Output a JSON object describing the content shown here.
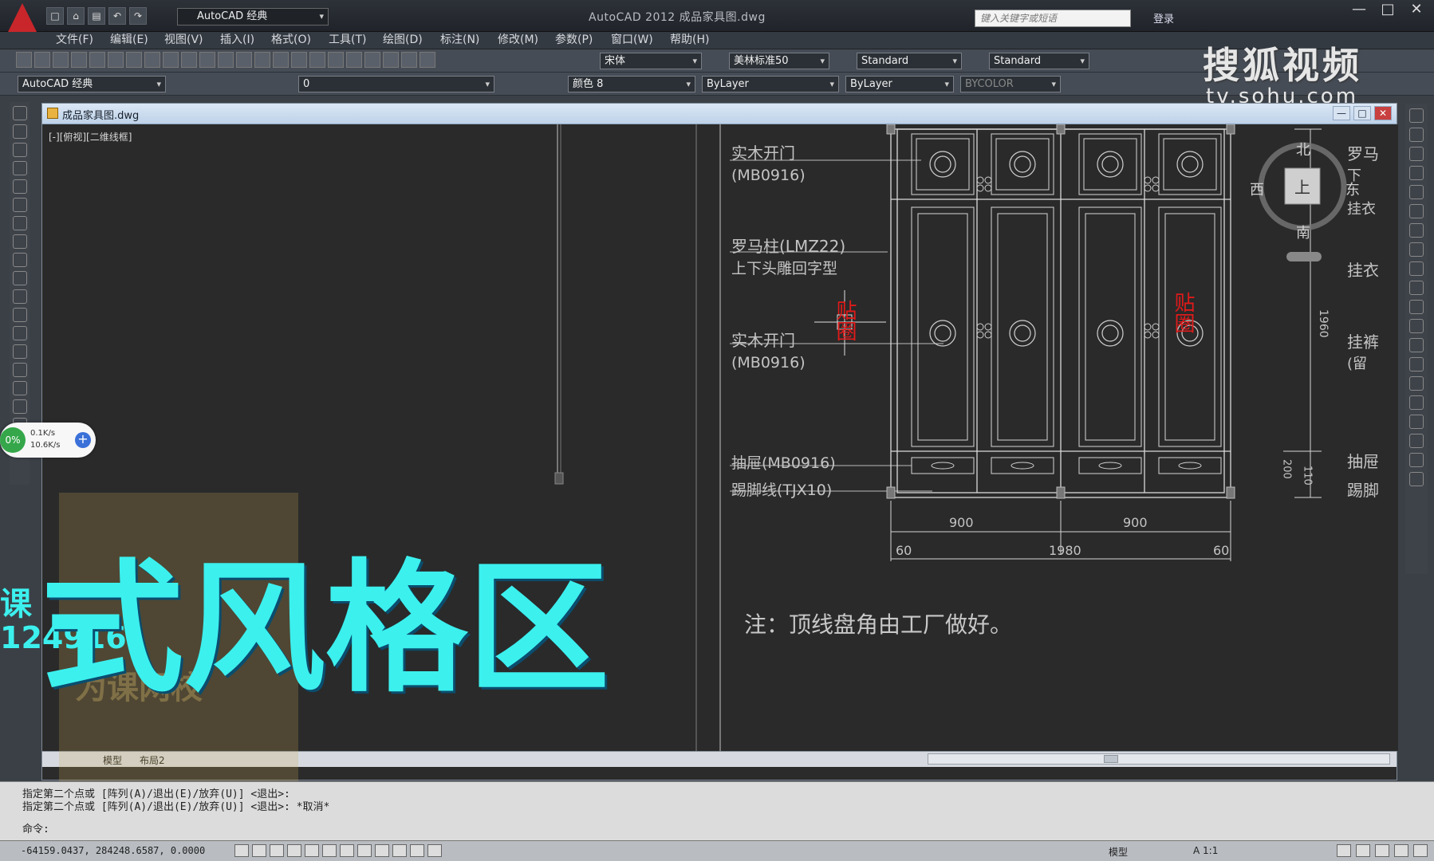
{
  "title_bar": {
    "workspace_label": "AutoCAD 经典",
    "window_title": "AutoCAD 2012  成品家具图.dwg",
    "search_placeholder": "键入关键字或短语",
    "login_label": "登录",
    "controls": [
      "—",
      "□",
      "✕"
    ]
  },
  "menu": [
    "文件(F)",
    "编辑(E)",
    "视图(V)",
    "插入(I)",
    "格式(O)",
    "工具(T)",
    "绘图(D)",
    "标注(N)",
    "修改(M)",
    "参数(P)",
    "窗口(W)",
    "帮助(H)"
  ],
  "toolbar": {
    "font_name": "宋体",
    "dim_style": "美林标准50",
    "text_style": "Standard",
    "table_style": "Standard",
    "workspace2": "AutoCAD 经典",
    "layer": "0",
    "color": "颜色 8",
    "linetype": "ByLayer",
    "lineweight": "ByLayer",
    "plot_style": "BYCOLOR"
  },
  "watermark": {
    "logo": "搜狐视频",
    "url": "tv.sohu.com"
  },
  "document": {
    "tab_title": "成品家具图.dwg",
    "viewport_label": "[-][俯视][二维线框]",
    "controls": [
      "—",
      "□",
      "✕"
    ]
  },
  "drawing": {
    "labels": {
      "door_top": "实木开门",
      "door_top_code": "(MB0916)",
      "roman_column": "罗马柱(LMZ22)",
      "roman_column_note": "上下头雕回字型",
      "door_mid": "实木开门",
      "door_mid_code": "(MB0916)",
      "drawer": "抽屉(MB0916)",
      "skirting": "踢脚线(TJX10)",
      "note": "注：顶线盘角由工厂做好。",
      "red_left": "贴圈",
      "red_right": "贴圈"
    },
    "dimensions": {
      "width_left": "900",
      "width_right": "900",
      "total": "1980",
      "side_left": "60",
      "side_right": "60",
      "height": "1960",
      "drawer_h1": "200",
      "drawer_h2": "110"
    },
    "right_cut_labels": {
      "a": "罗马",
      "b": "下",
      "c": "挂衣",
      "d": "挂衣",
      "e": "挂裤",
      "f": "(留",
      "g": "抽屉",
      "h": "踢脚"
    },
    "compass": {
      "north": "北",
      "south": "南",
      "west": "西",
      "east": "东",
      "top": "上"
    }
  },
  "layout_tabs": [
    "模型",
    "布局2"
  ],
  "overlay": {
    "big_text": "式风格区",
    "left_text1": "课",
    "left_text2": "1249161",
    "watermark_text": "为课网校"
  },
  "net_widget": {
    "percent": "0%",
    "upload": "0.1K/s",
    "download": "10.6K/s",
    "plus": "+"
  },
  "command": {
    "line1": "指定第二个点或 [阵列(A)/退出(E)/放弃(U)] <退出>:",
    "line2": "指定第二个点或 [阵列(A)/退出(E)/放弃(U)] <退出>: *取消*",
    "prompt": "命令:"
  },
  "status": {
    "coords": "-64159.0437,  284248.6587,  0.0000",
    "model": "模型",
    "scale": "A 1:1"
  }
}
